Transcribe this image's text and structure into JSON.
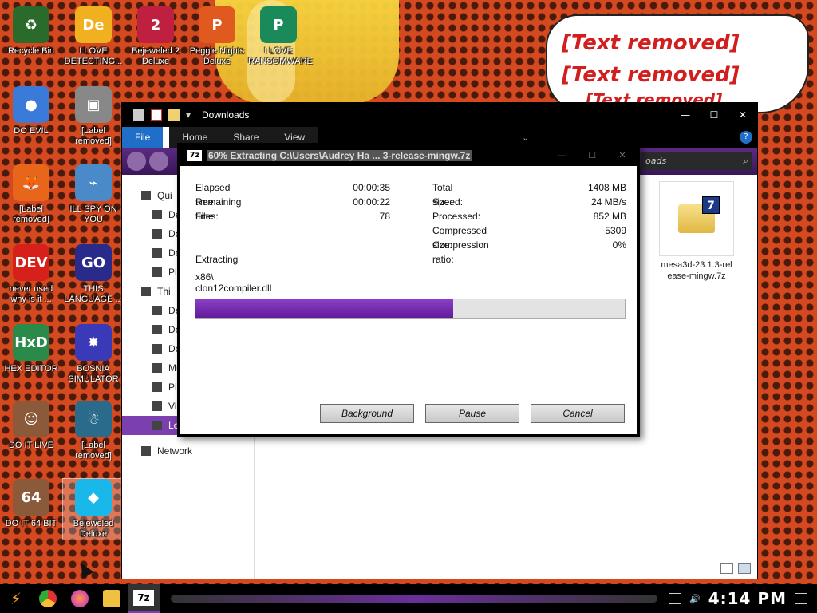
{
  "desktop": {
    "speech_bubble": {
      "line1": "[Text removed]",
      "line2": "[Text removed]",
      "line3": "[Text removed]"
    },
    "icons": [
      {
        "label": "Recycle Bin",
        "icon": "recycle-bin-icon",
        "color": "#2a6a2a",
        "glyph": "♻"
      },
      {
        "label": "I LOVE DETECTING...",
        "icon": "detective-app-icon",
        "color": "#f0b020",
        "glyph": "De"
      },
      {
        "label": "Bejeweled 2 Deluxe",
        "icon": "bejeweled-2-icon",
        "color": "#c02040",
        "glyph": "2"
      },
      {
        "label": "Peggle Nights Deluxe",
        "icon": "peggle-icon",
        "color": "#e05a20",
        "glyph": "P"
      },
      {
        "label": "I LOVE RANSOMWARE",
        "icon": "publisher-icon",
        "color": "#1a8a5a",
        "glyph": "P"
      },
      {
        "label": "DO EVIL",
        "icon": "chrome-icon",
        "color": "#3a7ad8",
        "glyph": "●"
      },
      {
        "label": "[Label removed]",
        "icon": "stacked-windows-icon",
        "color": "#888888",
        "glyph": "▣"
      },
      {
        "label": "[Label removed]",
        "icon": "firefox-icon",
        "color": "#e8661a",
        "glyph": "🦊"
      },
      {
        "label": "ILL SPY ON YOU",
        "icon": "network-spy-icon",
        "color": "#4a8ac8",
        "glyph": "⌁"
      },
      {
        "label": "never used why is it ...",
        "icon": "devcpp-icon",
        "color": "#d8201a",
        "glyph": "DEV"
      },
      {
        "label": "THIS LANGUAGE ...",
        "icon": "goland-icon",
        "color": "#2a2a8a",
        "glyph": "GO"
      },
      {
        "label": "HEX EDITOR",
        "icon": "hxd-icon",
        "color": "#2a8a4a",
        "glyph": "HxD"
      },
      {
        "label": "BOSNIA SIMULATOR",
        "icon": "mine-icon",
        "color": "#3a3ab8",
        "glyph": "✸"
      },
      {
        "label": "DO IT LIVE",
        "icon": "portrait-icon",
        "color": "#8a5a3a",
        "glyph": "☺"
      },
      {
        "label": "[Label removed]",
        "icon": "wizard-icon",
        "color": "#2a6a8a",
        "glyph": "☃"
      },
      {
        "label": "DO IT 64 BIT",
        "icon": "portrait-64-icon",
        "color": "#8a5a3a",
        "glyph": "64"
      },
      {
        "label": "Bejeweled Deluxe",
        "icon": "diamond-icon",
        "color": "#1ab8e8",
        "glyph": "◆"
      }
    ]
  },
  "explorer": {
    "title": "Downloads",
    "tabs": [
      "File",
      "Home",
      "Share",
      "View"
    ],
    "search_placeholder": "oads",
    "nav": [
      {
        "label": "Qui",
        "sub": false
      },
      {
        "label": "De",
        "sub": true
      },
      {
        "label": "Do",
        "sub": true
      },
      {
        "label": "Do",
        "sub": true
      },
      {
        "label": "Pi",
        "sub": true
      },
      {
        "label": "Thi",
        "sub": false
      },
      {
        "label": "De",
        "sub": true
      },
      {
        "label": "Do",
        "sub": true
      },
      {
        "label": "Do",
        "sub": true
      },
      {
        "label": "Mu",
        "sub": true
      },
      {
        "label": "Pi",
        "sub": true
      },
      {
        "label": "Vi",
        "sub": true
      },
      {
        "label": "Lo",
        "sub": true,
        "selected": true
      },
      {
        "label": "Network",
        "sub": false
      }
    ],
    "file": {
      "name_line1": "mesa3d-23.1.3-rel",
      "name_line2": "ease-mingw.7z"
    }
  },
  "dialog": {
    "title": "60% Extracting C:\\Users\\Audrey Ha ... 3-release-mingw.7z",
    "left_stats": [
      {
        "label": "Elapsed time:",
        "value": "00:00:35"
      },
      {
        "label": "Remaining time:",
        "value": "00:00:22"
      },
      {
        "label": "Files:",
        "value": "78"
      }
    ],
    "right_stats": [
      {
        "label": "Total size:",
        "value": "1408 MB"
      },
      {
        "label": "Speed:",
        "value": "24 MB/s"
      },
      {
        "label": "Processed:",
        "value": "852 MB"
      },
      {
        "label": "Compressed size:",
        "value": "5309"
      },
      {
        "label": "Compression ratio:",
        "value": "0%"
      }
    ],
    "status": "Extracting",
    "path_line1": "x86\\",
    "path_line2": "clon12compiler.dll",
    "progress": 0.6,
    "buttons": {
      "background": "Background",
      "pause": "Pause",
      "cancel": "Cancel"
    }
  },
  "taskbar": {
    "clock": "4:14 PM"
  }
}
